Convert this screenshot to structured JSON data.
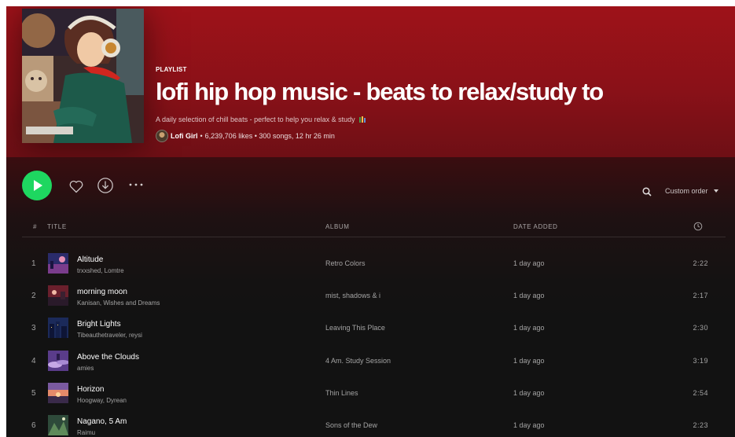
{
  "playlist": {
    "type_label": "PLAYLIST",
    "title": "lofi hip hop music - beats to relax/study to",
    "description": "A daily selection of chill beats - perfect to help you relax & study",
    "owner": "Lofi Girl",
    "stats": "6,239,706 likes • 300 songs, 12 hr 26 min"
  },
  "actions": {
    "sort_label": "Custom order"
  },
  "table": {
    "headers": {
      "num": "#",
      "title": "TITLE",
      "album": "ALBUM",
      "date": "DATE ADDED"
    },
    "rows": [
      {
        "num": "1",
        "title": "Altitude",
        "artists": "trxxshed, Lomtre",
        "album": "Retro Colors",
        "date_added": "1 day ago",
        "duration": "2:22"
      },
      {
        "num": "2",
        "title": "morning moon",
        "artists": "Kanisan, Wishes and Dreams",
        "album": "mist, shadows & i",
        "date_added": "1 day ago",
        "duration": "2:17"
      },
      {
        "num": "3",
        "title": "Bright Lights",
        "artists": "Tibeauthetraveler, reysi",
        "album": "Leaving This Place",
        "date_added": "1 day ago",
        "duration": "2:30"
      },
      {
        "num": "4",
        "title": "Above the Clouds",
        "artists": "amies",
        "album": "4 Am. Study Session",
        "date_added": "1 day ago",
        "duration": "3:19"
      },
      {
        "num": "5",
        "title": "Horizon",
        "artists": "Hoogway, Dyrean",
        "album": "Thin Lines",
        "date_added": "1 day ago",
        "duration": "2:54"
      },
      {
        "num": "6",
        "title": "Nagano, 5 Am",
        "artists": "Raimu",
        "album": "Sons of the Dew",
        "date_added": "1 day ago",
        "duration": "2:23"
      }
    ]
  },
  "colors": {
    "accent": "#1ed760",
    "hero": "#9e1219",
    "background": "#121212"
  },
  "icons": [
    "play-icon",
    "heart-icon",
    "download-icon",
    "more-icon",
    "search-icon",
    "caret-down-icon",
    "clock-icon",
    "books-icon"
  ]
}
